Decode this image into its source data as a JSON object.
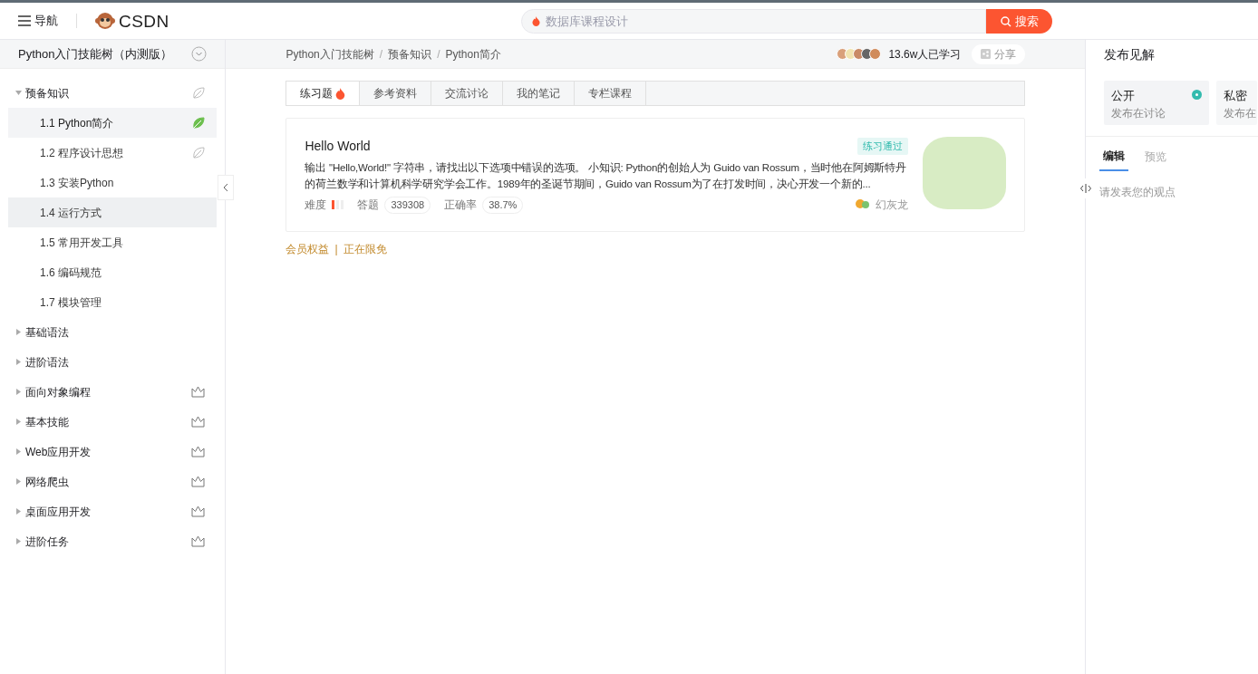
{
  "header": {
    "nav_label": "导航",
    "logo_text": "CSDN",
    "search": {
      "placeholder": "数据库课程设计"
    },
    "search_button": "搜索"
  },
  "sidebar": {
    "title": "Python入门技能树（内测版）",
    "sections": [
      {
        "label": "预备知识",
        "expanded": true,
        "kind": "leaf",
        "done": false,
        "children": [
          {
            "label": "1.1 Python简介",
            "selected": true,
            "hovered": false,
            "kind": "leaf",
            "done": true
          },
          {
            "label": "1.2 程序设计思想",
            "selected": false,
            "hovered": false,
            "kind": "leaf",
            "done": false
          },
          {
            "label": "1.3 安装Python",
            "selected": false,
            "hovered": false,
            "kind": "plain"
          },
          {
            "label": "1.4 运行方式",
            "selected": false,
            "hovered": true,
            "kind": "plain"
          },
          {
            "label": "1.5 常用开发工具",
            "selected": false,
            "hovered": false,
            "kind": "plain"
          },
          {
            "label": "1.6 编码规范",
            "selected": false,
            "hovered": false,
            "kind": "plain"
          },
          {
            "label": "1.7 模块管理",
            "selected": false,
            "hovered": false,
            "kind": "plain"
          }
        ]
      },
      {
        "label": "基础语法",
        "expanded": false,
        "kind": "plain"
      },
      {
        "label": "进阶语法",
        "expanded": false,
        "kind": "plain"
      },
      {
        "label": "面向对象编程",
        "expanded": false,
        "kind": "crown"
      },
      {
        "label": "基本技能",
        "expanded": false,
        "kind": "crown"
      },
      {
        "label": "Web应用开发",
        "expanded": false,
        "kind": "crown"
      },
      {
        "label": "网络爬虫",
        "expanded": false,
        "kind": "crown"
      },
      {
        "label": "桌面应用开发",
        "expanded": false,
        "kind": "crown"
      },
      {
        "label": "进阶任务",
        "expanded": false,
        "kind": "crown"
      }
    ]
  },
  "breadcrumb": {
    "separator": "/",
    "items": [
      "Python入门技能树",
      "预备知识",
      "Python简介"
    ]
  },
  "learners": "13.6w人已学习",
  "share": "分享",
  "tabs": [
    {
      "label": "练习题",
      "selected": true,
      "hot": true
    },
    {
      "label": "参考资料",
      "selected": false,
      "hot": false
    },
    {
      "label": "交流讨论",
      "selected": false,
      "hot": false
    },
    {
      "label": "我的笔记",
      "selected": false,
      "hot": false
    },
    {
      "label": "专栏课程",
      "selected": false,
      "hot": false
    }
  ],
  "exercise": {
    "title": "Hello World",
    "badge": "练习通过",
    "description": "输出 \"Hello,World!\" 字符串，请找出以下选项中错误的选项。 小知识: Python的创始人为 Guido van Rossum，当时他在阿姆斯特丹的荷兰数学和计算机科学研究学会工作。1989年的圣诞节期间，Guido van Rossum为了在打发时间，决心开发一个新的...",
    "difficulty_label": "难度",
    "difficulty": {
      "level": 0.33
    },
    "answers_label": "答题",
    "answers": "339308",
    "accuracy_label": "正确率",
    "accuracy": "38.7%",
    "author": "幻灰龙"
  },
  "member_links": {
    "separator": "|",
    "items": [
      "会员权益",
      "正在限免"
    ]
  },
  "right_panel": {
    "title": "发布见解",
    "visibility": [
      {
        "label": "公开",
        "sub": "发布在讨论",
        "selected": true
      },
      {
        "label": "私密",
        "sub": "发布在",
        "selected": false
      }
    ],
    "editor_tabs": [
      {
        "label": "编辑",
        "selected": true
      },
      {
        "label": "预览",
        "selected": false
      }
    ],
    "placeholder": "请发表您的观点"
  }
}
